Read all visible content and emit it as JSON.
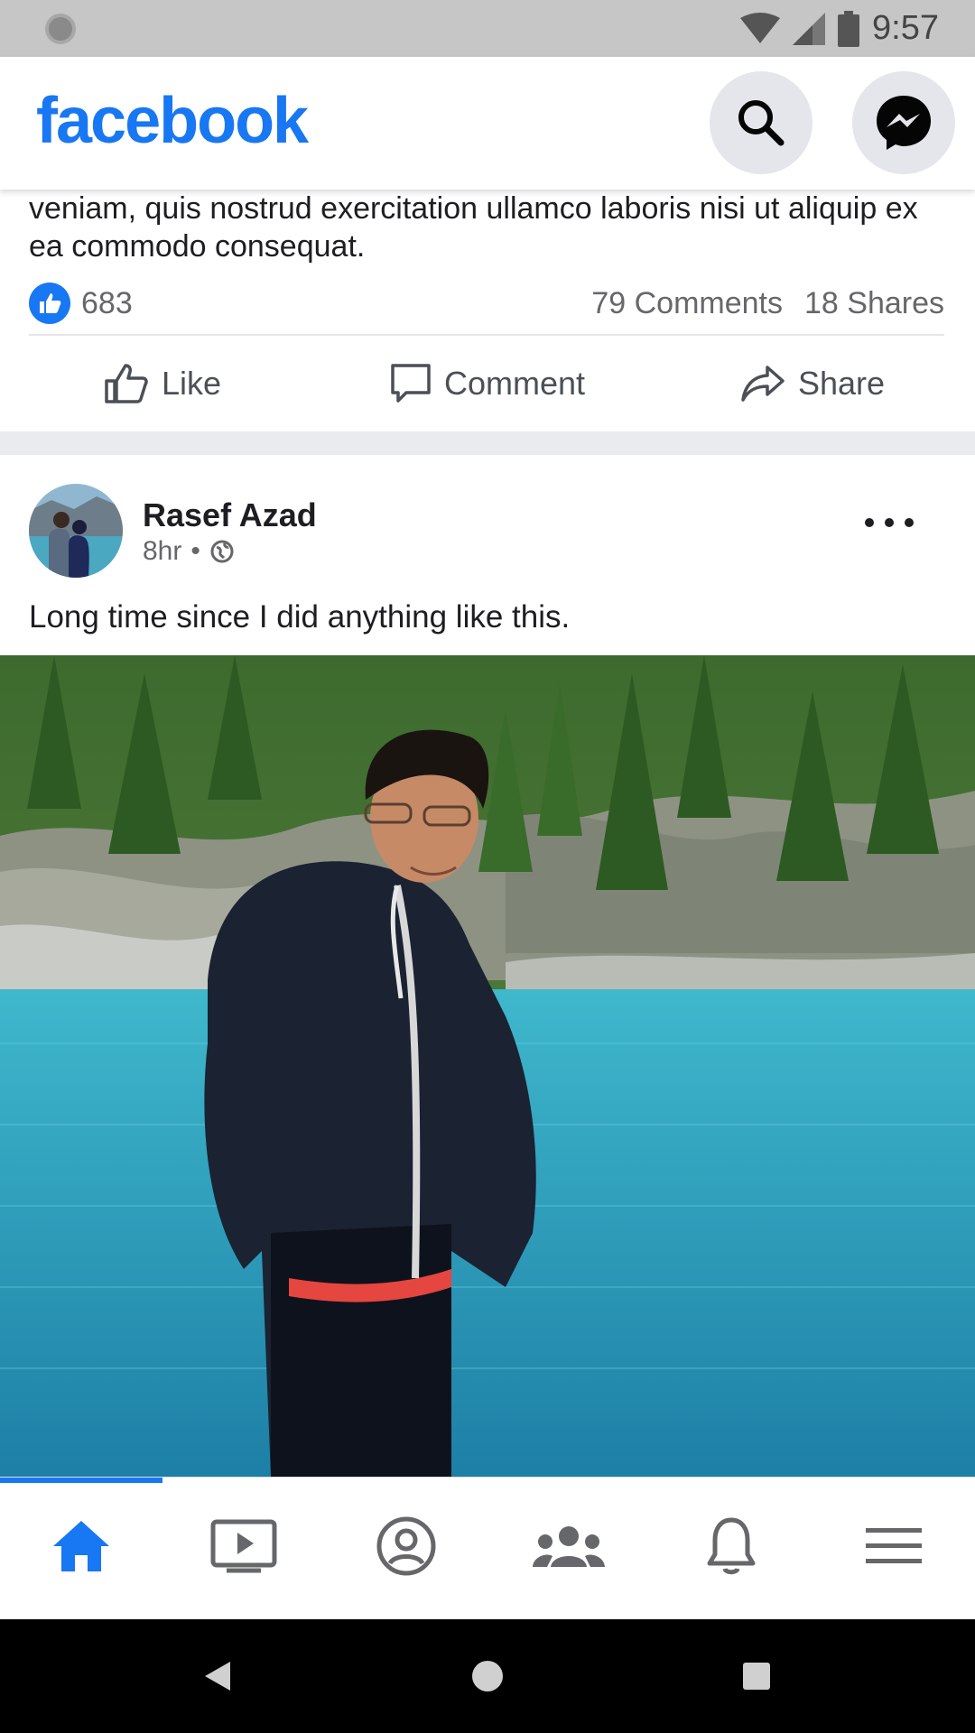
{
  "status_bar": {
    "time": "9:57"
  },
  "header": {
    "logo": "facebook",
    "search_icon": "search-icon",
    "messenger_icon": "messenger-icon"
  },
  "prev_post": {
    "text": "veniam, quis nostrud exercitation ullamco laboris nisi ut aliquip ex ea commodo consequat.",
    "likes": "683",
    "comments": "79 Comments",
    "shares": "18 Shares",
    "actions": {
      "like": "Like",
      "comment": "Comment",
      "share": "Share"
    }
  },
  "post": {
    "author": "Rasef Azad",
    "time": "8hr",
    "text": "Long time since I did anything like this."
  },
  "bottom_nav": {
    "items": [
      "home-icon",
      "video-icon",
      "profile-icon",
      "groups-icon",
      "notifications-icon",
      "menu-icon"
    ],
    "active": "home-icon"
  },
  "colors": {
    "brand": "#1877f2",
    "secondary_text": "#65676b"
  }
}
